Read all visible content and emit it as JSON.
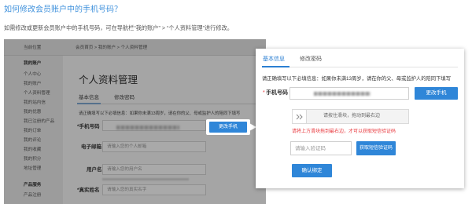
{
  "article": {
    "title": "如何修改会员账户中的手机号码？",
    "description": "如需修改或更新会员账户中的手机号码，可在导航栏“我的账户” > “个人资料管理”进行修改。"
  },
  "background_page": {
    "location_label": "当前位置",
    "breadcrumb": "会员首页 > 我的账户 > 个人资料管理",
    "sidebar": {
      "account_title": "我的账户",
      "account_items": [
        "个人中心",
        "我的账户",
        "个人资料管理",
        "我的站内信",
        "我的优惠",
        "我已注册的产品",
        "我的订单",
        "我的评论",
        "我的收藏",
        "我的积分",
        "地址管理"
      ],
      "service_title": "产品服务",
      "service_items": [
        "产品注册"
      ]
    },
    "page_title": "个人资料管理",
    "tabs": [
      "基本信息",
      "修改密码"
    ],
    "notice": "请正确填写以下必填信息：如果你未满13周岁，请在你的父、母或监护人的陪同下填写",
    "phone_label": "*手机号码",
    "change_phone_label": "更改手机",
    "email_label": "电子邮箱",
    "email_placeholder": "请输入您的个人邮箱",
    "username_label": "用户名",
    "username_placeholder": "请输入您的用户名",
    "realname_label": "*真实姓名",
    "realname_placeholder": "请输入您的真实名字"
  },
  "dialog": {
    "tabs": [
      {
        "label": "基本信息",
        "active": true
      },
      {
        "label": "修改密码",
        "active": false
      }
    ],
    "notice": "请正确填写以下必填信息：如果你未满13周岁，请在你的父、母或监护人的陪同下填写",
    "required_mark": "*",
    "phone_label": "手机号码",
    "change_phone_label": "更改手机",
    "slider": {
      "handle_icon": "double-chevron-right-icon",
      "text": "请按住滑块，拖动到最右边"
    },
    "slider_error": "请将上方滑块拖到最右边，才可以获取短信验证码",
    "code_placeholder": "请输入验证码",
    "get_code_label": "获取短信验证码",
    "confirm_label": "确认绑定"
  },
  "colors": {
    "title_blue": "#3f91dc",
    "button_blue": "#2f86d8",
    "active_tab_blue": "#2b7fd2",
    "error_red": "#e8383d",
    "overlay_gray": "#a5a5a5"
  }
}
